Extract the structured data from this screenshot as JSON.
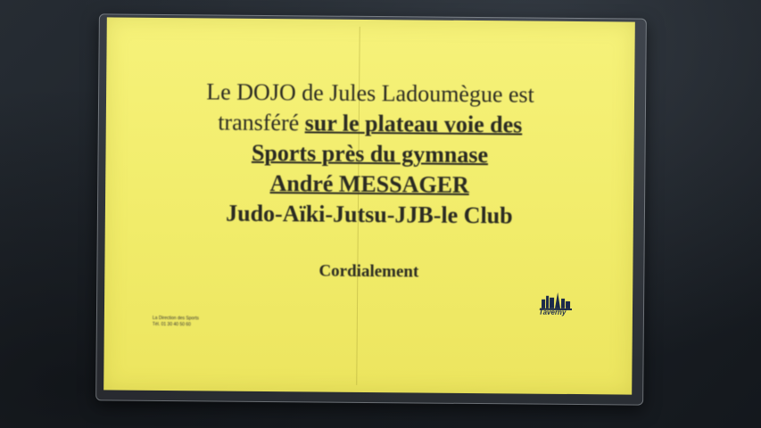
{
  "notice": {
    "line1": "Le DOJO de Jules Ladoumègue est",
    "line2_plain": "transféré ",
    "line2_bold": "sur le plateau voie des",
    "line3": "Sports près du gymnase",
    "line4": "André MESSAGER",
    "line5": "Judo-Aïki-Jutsu-JJB-le Club",
    "closing": "Cordialement"
  },
  "footer": {
    "line1": "La Direction des Sports",
    "line2": "Tél. 01 30 40 50 60"
  },
  "logo": {
    "icon": "taverny-logo-icon",
    "text": "Taverny"
  },
  "colors": {
    "paper": "#f3ef6f",
    "ink": "#2a2a22",
    "background": "#1e2329"
  }
}
